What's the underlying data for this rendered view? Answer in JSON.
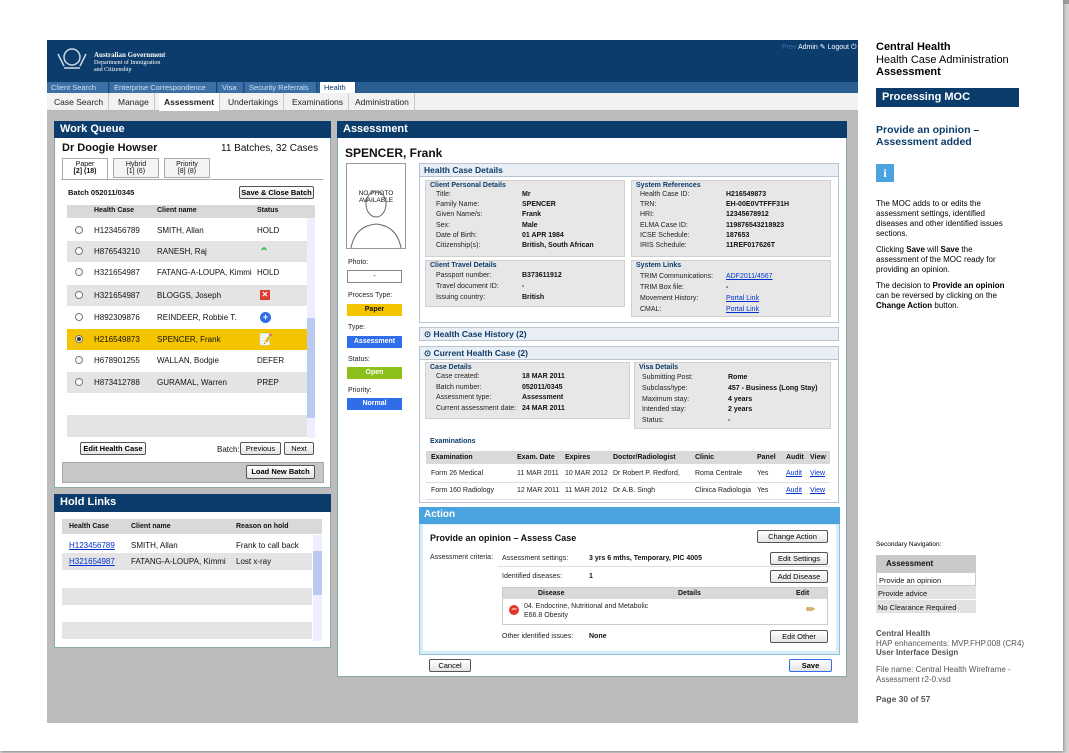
{
  "govt": {
    "line1": "Australian Government",
    "line2": "Department of Immigration",
    "line3": "and Citizenship"
  },
  "admin": {
    "prev": "Prev",
    "label": "Admin",
    "logout": "Logout"
  },
  "top_tabs": [
    "Client Search",
    "Enterprise Correspondence",
    "Visa",
    "Security Referrals",
    "Health"
  ],
  "sub_tabs": [
    "Case Search",
    "Manage",
    "Assessment",
    "Undertakings",
    "Examinations",
    "Administration"
  ],
  "work_queue": {
    "title": "Work Queue",
    "doctor": "Dr Doogie Howser",
    "batches": "11 Batches, 32 Cases",
    "tabs": [
      {
        "label": "Paper",
        "count": "[2] (18)"
      },
      {
        "label": "Hybrid",
        "count": "[1] (6)"
      },
      {
        "label": "Priority",
        "count": "[8] (8)"
      }
    ],
    "batch": "Batch 052011/0345",
    "save_close": "Save & Close Batch",
    "headers": [
      "Health Case",
      "Client name",
      "Status"
    ],
    "rows": [
      {
        "id": "H123456789",
        "name": "SMITH, Allan",
        "status": "HOLD"
      },
      {
        "id": "H876543210",
        "name": "RANESH, Raj",
        "status": ""
      },
      {
        "id": "H321654987",
        "name": "FATANG-A-LOUPA, Kimmi",
        "status": "HOLD"
      },
      {
        "id": "H321654987",
        "name": "BLOGGS, Joseph",
        "status": ""
      },
      {
        "id": "H892309876",
        "name": "REINDEER, Robbie T.",
        "status": ""
      },
      {
        "id": "H216549873",
        "name": "SPENCER, Frank",
        "status": ""
      },
      {
        "id": "H678901255",
        "name": "WALLAN, Bodgie",
        "status": "DEFER"
      },
      {
        "id": "H873412788",
        "name": "GURAMAL, Warren",
        "status": "PREP"
      }
    ],
    "edit": "Edit Health Case",
    "batch_label": "Batch:",
    "previous": "Previous",
    "next": "Next",
    "load": "Load New Batch"
  },
  "hold_links": {
    "title": "Hold Links",
    "headers": [
      "Health Case",
      "Client name",
      "Reason on hold"
    ],
    "rows": [
      {
        "id": "H123456789",
        "name": "SMITH, Allan",
        "reason": "Frank to call back"
      },
      {
        "id": "H321654987",
        "name": "FATANG-A-LOUPA, Kimmi",
        "reason": "Lost x-ray"
      }
    ]
  },
  "assessment": {
    "title": "Assessment",
    "client": "SPENCER, Frank",
    "photo": "NO PHOTO AVAILABLE",
    "photo_label": "Photo:",
    "photo_val": "-",
    "process_label": "Process Type:",
    "process": "Paper",
    "type_label": "Type:",
    "type": "Assessment",
    "status_label": "Status:",
    "status": "Open",
    "priority_label": "Priority:",
    "priority": "Normal",
    "hcd": "Health Case Details",
    "cpd": "Client Personal Details",
    "personal": [
      [
        "Title:",
        "Mr"
      ],
      [
        "Family Name:",
        "SPENCER"
      ],
      [
        "Given Name/s:",
        "Frank"
      ],
      [
        "Sex:",
        "Male"
      ],
      [
        "Date of Birth:",
        "01 APR 1984"
      ],
      [
        "Citizenship(s):",
        "British, South African"
      ]
    ],
    "sysref": "System References",
    "refs": [
      [
        "Health Case ID:",
        "H216549873"
      ],
      [
        "TRN:",
        "EH-00E0VTFFF31H"
      ],
      [
        "HRI:",
        "12345678912"
      ],
      [
        "ELMA Case ID:",
        "119876543218923"
      ],
      [
        "ICSE Schedule:",
        "187653"
      ],
      [
        "IRIS Schedule:",
        "11REF017626T"
      ]
    ],
    "ctd": "Client Travel Details",
    "travel": [
      [
        "Passport number:",
        "B373611912"
      ],
      [
        "Travel document ID:",
        "-"
      ],
      [
        "Issuing country:",
        "British"
      ]
    ],
    "syslinks": "System Links",
    "links": [
      [
        "TRIM Communications:",
        "ADF2011/4567"
      ],
      [
        "TRIM Box file:",
        "-"
      ],
      [
        "Movement History:",
        "Portal Link"
      ],
      [
        "CMAL:",
        "Portal Link"
      ]
    ],
    "history": "Health Case History (2)",
    "current": "Current Health Case (2)",
    "case_details": "Case Details",
    "case": [
      [
        "Case created:",
        "18 MAR 2011"
      ],
      [
        "Batch number:",
        "052011/0345"
      ],
      [
        "Assessment type:",
        "Assessment"
      ],
      [
        "Current assessment date:",
        "24 MAR 2011"
      ]
    ],
    "visa_details": "Visa Details",
    "visa": [
      [
        "Submitting Post:",
        "Rome"
      ],
      [
        "Subclass/type:",
        "457 - Business (Long Stay)"
      ],
      [
        "Maximum stay:",
        "4 years"
      ],
      [
        "Intended stay:",
        "2 years"
      ],
      [
        "Status:",
        "-"
      ]
    ],
    "exams_title": "Examinations",
    "exam_headers": [
      "Examination",
      "Exam. Date",
      "Expires",
      "Doctor/Radiologist",
      "Clinic",
      "Panel",
      "Audit",
      "View"
    ],
    "exams": [
      [
        "Form 26 Medical",
        "11 MAR 2011",
        "10 MAR 2012",
        "Dr Robert P. Redford,",
        "Roma Centrale",
        "Yes",
        "Audit",
        "View"
      ],
      [
        "Form 160 Radiology",
        "12 MAR 2011",
        "11 MAR 2012",
        "Dr A.B. Singh",
        "Clinica Radiologia",
        "Yes",
        "Audit",
        "View"
      ]
    ]
  },
  "action": {
    "title": "Action",
    "heading": "Provide an opinion – Assess Case",
    "change": "Change Action",
    "criteria": "Assessment criteria:",
    "settings_label": "Assessment settings:",
    "settings": "3 yrs 6 mths, Temporary, PIC 4005",
    "edit_settings": "Edit Settings",
    "diseases_label": "Identified diseases:",
    "diseases": "1",
    "add_disease": "Add Disease",
    "dh": [
      "Disease",
      "Details",
      "Edit"
    ],
    "disease1": "04. Endocrine, Nutritional and Metabolic",
    "disease2": "E66.8 Obesity",
    "other_label": "Other identified issues:",
    "other": "None",
    "edit_other": "Edit Other",
    "cancel": "Cancel",
    "save": "Save"
  },
  "side": {
    "h1": "Central Health",
    "h2": "Health Case Administration",
    "h3": "Assessment",
    "banner": "Processing MOC",
    "opinion": "Provide an opinion – Assessment added",
    "info": "i",
    "p1": "The MOC adds to or edits the assessment settings, identified diseases and other identified issues sections.",
    "p2a": "Clicking ",
    "p2b": "Save",
    "p2c": " will ",
    "p2d": "Save",
    "p2e": " the assessment of the MOC ready for providing an opinion.",
    "p3a": "The decision to ",
    "p3b": "Provide an opinion",
    "p3c": " can be reversed by clicking on the ",
    "p3d": "Change Action",
    "p3e": " button.",
    "secnav": "Secondary Navigation:",
    "nav_head": "Assessment",
    "nav": [
      "Provide an opinion",
      "Provide advice",
      "No Clearance Required"
    ],
    "f1": "Central Health",
    "f2": "HAP enhancements: MVP.FHP.008 (CR4)",
    "f3": "User Interface Design",
    "f4": "File name: Central Health Wireframe - Assessment r2-0.vsd",
    "page": "Page 30 of 57"
  },
  "colors": {
    "navy": "#0b3c6b",
    "yellow": "#f5c400",
    "blue": "#2f6ee8",
    "green": "#8cc01a",
    "accent": "#4aa3df"
  }
}
